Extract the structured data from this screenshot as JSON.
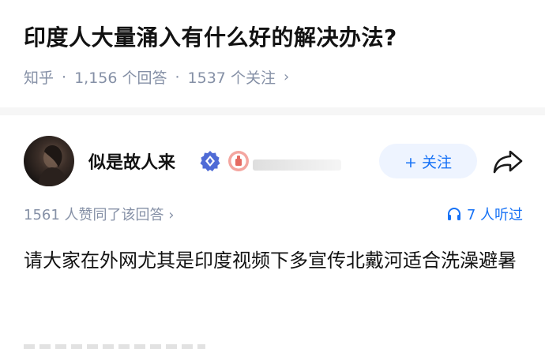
{
  "question": {
    "title": "印度人大量涌入有什么好的解决办法?",
    "source": "知乎",
    "answer_count": "1,156 个回答",
    "follower_count": "1537 个关注",
    "separator": "·",
    "chevron": "›"
  },
  "author": {
    "name": "似是故人来",
    "follow_label": "+ 关注",
    "verify_icon": "verified-badge-icon",
    "badge_icon": "creator-badge-icon",
    "share_icon": "share-arrow-icon"
  },
  "answer": {
    "likes_text": "1561 人赞同了该回答 ›",
    "listeners_text": "7 人听过",
    "body": "请大家在外网尤其是印度视频下多宣传北戴河适合洗澡避暑"
  },
  "colors": {
    "accent": "#1772f6",
    "muted": "#8590a6",
    "follow_bg": "#eef4ff"
  }
}
